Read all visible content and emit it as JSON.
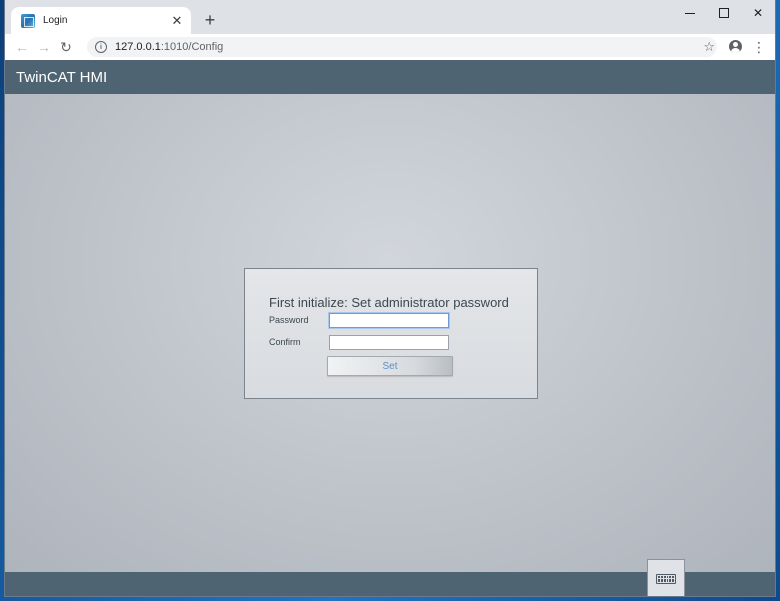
{
  "browser": {
    "tab": {
      "title": "Login",
      "close_glyph": "✕"
    },
    "new_tab_glyph": "+",
    "window_controls": {
      "close_glyph": "✕"
    },
    "nav": {
      "back_glyph": "←",
      "forward_glyph": "→",
      "reload_glyph": "↻"
    },
    "address": {
      "host": "127.0.0.1",
      "port_path": ":1010/Config"
    },
    "star_glyph": "☆",
    "menu_glyph": "⋮",
    "icons": [
      "favicon-icon",
      "close-icon",
      "plus-icon",
      "minimize-icon",
      "maximize-icon",
      "back-arrow-icon",
      "forward-arrow-icon",
      "reload-icon",
      "info-icon",
      "star-icon",
      "profile-icon",
      "kebab-menu-icon"
    ]
  },
  "hmi": {
    "title": "TwinCAT HMI",
    "dialog": {
      "heading": "First initialize: Set administrator password",
      "password_label": "Password",
      "password_value": "",
      "confirm_label": "Confirm",
      "confirm_value": "",
      "set_label": "Set"
    },
    "footer": {
      "keyboard_icon": "keyboard-icon"
    }
  },
  "colors": {
    "header_bar": "#4f6473",
    "set_label": "#5b8fc8",
    "focus_ring": "#6e9bd8"
  }
}
